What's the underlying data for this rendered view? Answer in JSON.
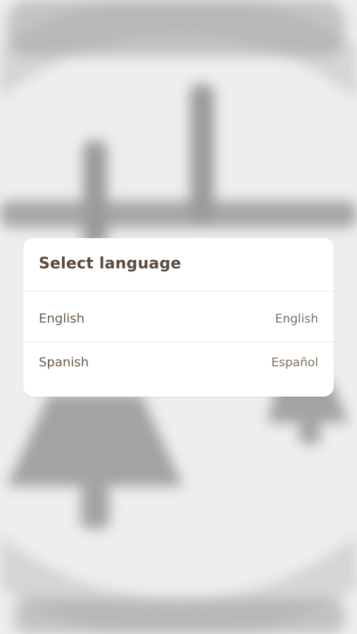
{
  "dialog": {
    "title": "Select language",
    "options": [
      {
        "label": "English",
        "native": "English"
      },
      {
        "label": "Spanish",
        "native": "Español"
      }
    ]
  },
  "colors": {
    "title": "#5a4b3e",
    "text": "#6a5a4b",
    "native_text": "#7d6f62",
    "background": "#eeeeee",
    "artwork": "#8f8f8f"
  }
}
